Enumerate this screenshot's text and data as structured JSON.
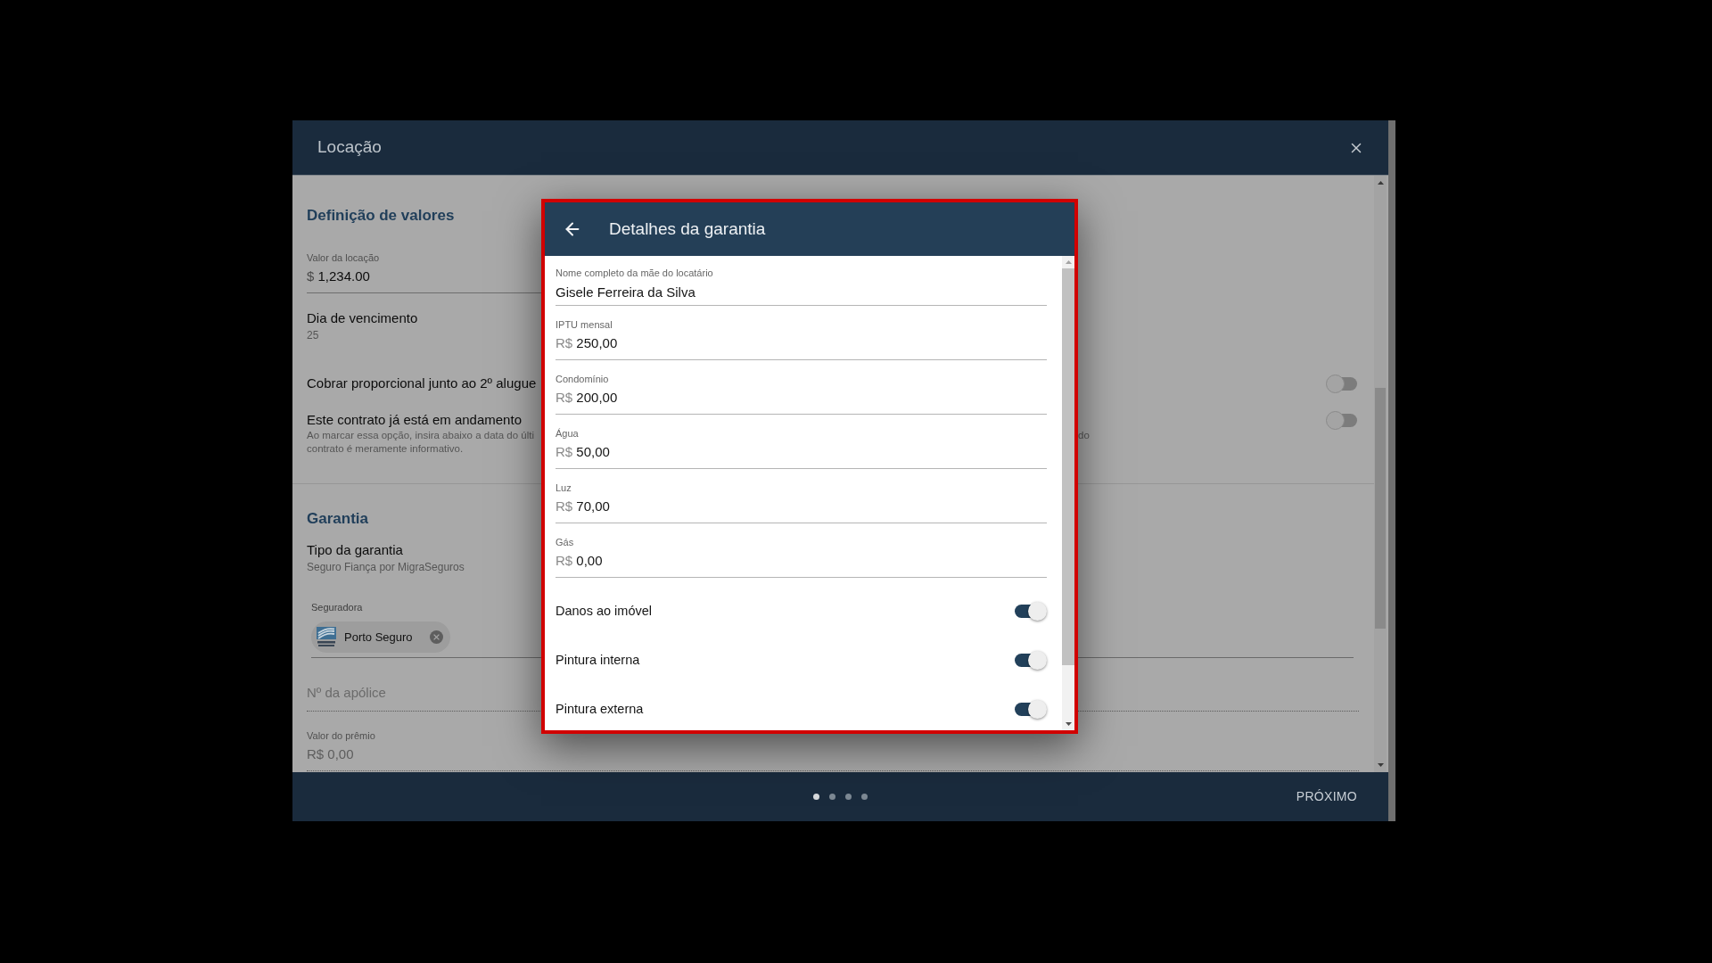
{
  "window": {
    "title": "Locação"
  },
  "form": {
    "sections": [
      {
        "title": "Definição de valores",
        "items": [
          {
            "kind": "field",
            "label": "Valor da locação",
            "prefix": "$",
            "value": "1,234.00",
            "disabled": false
          },
          {
            "kind": "info",
            "label": "Dia de vencimento",
            "value": "25"
          },
          {
            "kind": "toggle",
            "label": "Cobrar proporcional junto ao 2º alugue",
            "checked": false
          },
          {
            "kind": "toggle",
            "label": "Este contrato já está em andamento",
            "description_lines": [
              "Ao marcar essa opção, insira abaixo a data do últi",
              "contrato é meramente informativo."
            ],
            "description_tail": "do",
            "checked": false
          }
        ]
      },
      {
        "title": "Garantia",
        "items": [
          {
            "kind": "info",
            "label": "Tipo da garantia",
            "value": "Seguro Fiança por MigraSeguros"
          },
          {
            "kind": "chips",
            "label": "Seguradora",
            "chips": [
              {
                "text": "Porto Seguro"
              }
            ]
          },
          {
            "kind": "input",
            "placeholder": "Nº da apólice"
          },
          {
            "kind": "field",
            "label": "Valor do prêmio",
            "prefix": "R$",
            "value": "0,00",
            "disabled": true
          }
        ]
      }
    ]
  },
  "dialog": {
    "title": "Detalhes da garantia",
    "fields": [
      {
        "label": "Nome completo da mãe do locatário",
        "value": "Gisele Ferreira da Silva"
      },
      {
        "label": "IPTU mensal",
        "prefix": "R$",
        "value": "250,00"
      },
      {
        "label": "Condomínio",
        "prefix": "R$",
        "value": "200,00"
      },
      {
        "label": "Água",
        "prefix": "R$",
        "value": "50,00"
      },
      {
        "label": "Luz",
        "prefix": "R$",
        "value": "70,00"
      },
      {
        "label": "Gás",
        "prefix": "R$",
        "value": "0,00"
      }
    ],
    "switches": [
      {
        "label": "Danos ao imóvel",
        "checked": true
      },
      {
        "label": "Pintura interna",
        "checked": true
      },
      {
        "label": "Pintura externa",
        "checked": true
      }
    ]
  },
  "footer": {
    "pages": [
      {
        "selected": true
      },
      {
        "selected": false
      },
      {
        "selected": false
      },
      {
        "selected": false
      }
    ],
    "next_button": "PRÓXIMO"
  }
}
